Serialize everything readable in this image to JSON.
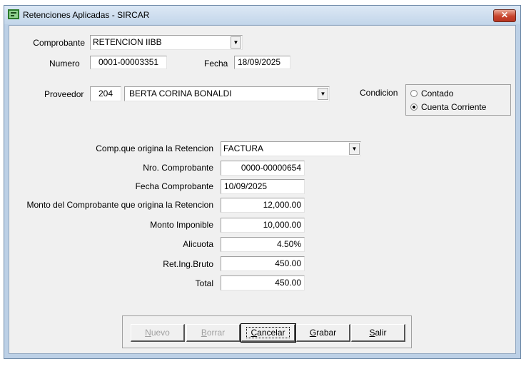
{
  "window": {
    "title": "Retenciones Aplicadas - SIRCAR",
    "close_label": "✕"
  },
  "form": {
    "comprobante_label": "Comprobante",
    "comprobante_value": "RETENCION IIBB",
    "numero_label": "Numero",
    "numero_value": "0001-00003351",
    "fecha_label": "Fecha",
    "fecha_value": "18/09/2025",
    "proveedor_label": "Proveedor",
    "proveedor_code": "204",
    "proveedor_name": "BERTA CORINA BONALDI",
    "condicion_label": "Condicion",
    "condicion_options": [
      {
        "label": "Contado",
        "selected": false
      },
      {
        "label": "Cuenta Corriente",
        "selected": true
      }
    ],
    "comp_origina_label": "Comp.que origina la Retencion",
    "comp_origina_value": "FACTURA",
    "nro_comprobante_label": "Nro. Comprobante",
    "nro_comprobante_value": "0000-00000654",
    "fecha_comprobante_label": "Fecha Comprobante",
    "fecha_comprobante_value": "10/09/2025",
    "monto_comprobante_label": "Monto del Comprobante que origina la Retencion",
    "monto_comprobante_value": "12,000.00",
    "monto_imponible_label": "Monto Imponible",
    "monto_imponible_value": "10,000.00",
    "alicuota_label": "Alicuota",
    "alicuota_value": "4.50%",
    "ret_ing_bruto_label": "Ret.Ing.Bruto",
    "ret_ing_bruto_value": "450.00",
    "total_label": "Total",
    "total_value": "450.00"
  },
  "buttons": {
    "nuevo": {
      "first": "N",
      "rest": "uevo",
      "enabled": false
    },
    "borrar": {
      "first": "B",
      "rest": "orrar",
      "enabled": false
    },
    "cancelar": {
      "first": "C",
      "rest": "ancelar",
      "enabled": true
    },
    "grabar": {
      "first": "G",
      "rest": "rabar",
      "enabled": true
    },
    "salir": {
      "first": "S",
      "rest": "alir",
      "enabled": true
    }
  },
  "icons": {
    "app": "app-icon",
    "dropdown": "chevron-down-icon"
  }
}
